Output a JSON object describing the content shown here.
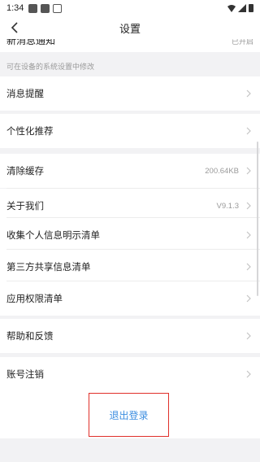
{
  "status_bar": {
    "time": "1:34"
  },
  "header": {
    "title": "设置"
  },
  "partial_item": {
    "label": "新消息通知",
    "value": "已开启"
  },
  "hint": "可在设备的系统设置中修改",
  "items": [
    {
      "label": "消息提醒",
      "value": ""
    },
    {
      "label": "个性化推荐",
      "value": ""
    },
    {
      "label": "清除缓存",
      "value": "200.64KB"
    },
    {
      "label": "关于我们",
      "value": "V9.1.3"
    },
    {
      "label": "收集个人信息明示清单",
      "value": ""
    },
    {
      "label": "第三方共享信息清单",
      "value": ""
    },
    {
      "label": "应用权限清单",
      "value": ""
    },
    {
      "label": "帮助和反馈",
      "value": ""
    },
    {
      "label": "账号注销",
      "value": ""
    }
  ],
  "logout": {
    "label": "退出登录"
  },
  "colors": {
    "accent": "#3c8ee0",
    "highlight_border": "#e0302a",
    "background": "#f2f2f4"
  }
}
